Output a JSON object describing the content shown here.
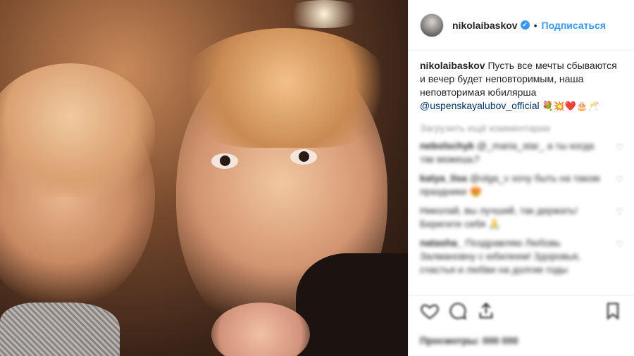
{
  "post": {
    "username": "nikolaibaskov",
    "verified_mark": "✔",
    "separator": "•",
    "follow_label": "Подписаться",
    "caption_text": "Пусть все мечты сбываются и вечер будет неповторимым, наша неповторимая юбилярша",
    "caption_mention": "@uspenskayalubov_official",
    "caption_emoji": "💐💥❤️🎂🥂",
    "load_more": "Загрузить ещё комментарии"
  },
  "comments": [
    {
      "user": "nebolschyk",
      "text": "@_maria_star_ а ты когда так можешь?"
    },
    {
      "user": "katya_lisa",
      "text": "@olga_v хочу быть на таком празднике 😍"
    },
    {
      "user": "",
      "text": "Николай, вы лучший, так держать! Берегите себя 🙏"
    },
    {
      "user": "natasha_",
      "text": "Поздравляю Любовь Залмановну с юбилеем! Здоровья, счастья и любви на долгие годы"
    }
  ],
  "footer": {
    "views_label": "Просмотры: 000 000"
  },
  "colors": {
    "accent": "#3897f0",
    "text": "#262626",
    "muted": "#999999"
  },
  "icons": [
    "like-icon",
    "comment-icon",
    "share-icon",
    "bookmark-icon"
  ]
}
